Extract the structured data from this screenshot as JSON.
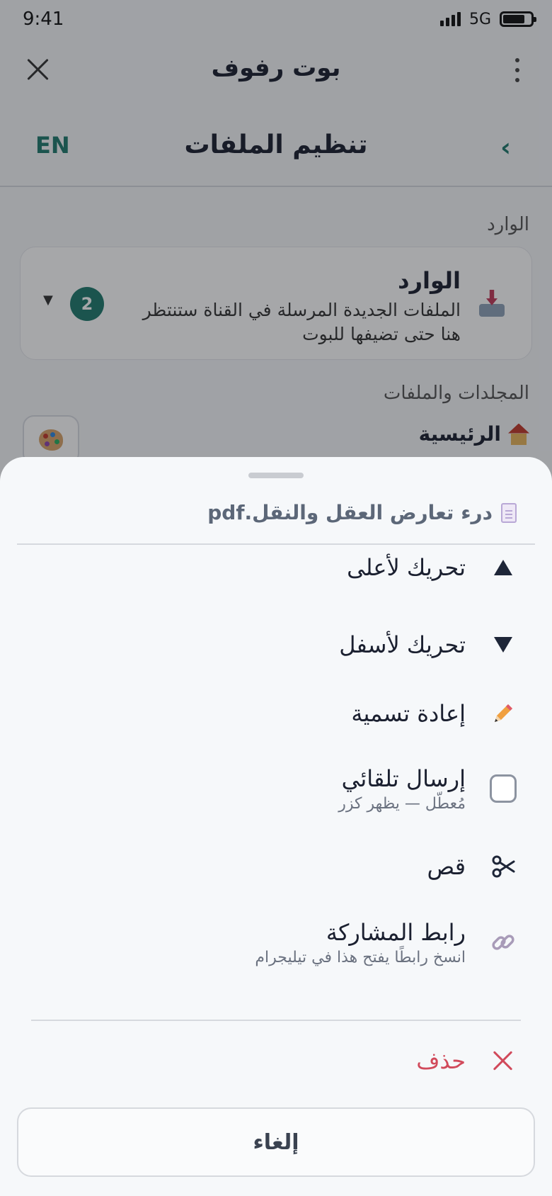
{
  "status_bar": {
    "time": "9:41",
    "network": "5G"
  },
  "app_bar": {
    "title": "بوت رفوف"
  },
  "page_header": {
    "title": "تنظيم الملفات",
    "lang_toggle": "EN",
    "back_glyph": "›"
  },
  "inbox_section": {
    "label": "الوارد",
    "card_title": "الوارد",
    "card_description": "الملفات الجديدة المرسلة في القناة ستنتظر هنا حتى تضيفها للبوت",
    "count": "2",
    "expand_glyph": "▼"
  },
  "folders_section": {
    "label": "المجلدات والملفات",
    "home_label": "الرئيسية"
  },
  "sheet": {
    "file_name": "درء تعارض العقل والنقل.pdf",
    "items": [
      {
        "label": "تحريك لأعلى",
        "icon": "triangle-up-icon"
      },
      {
        "label": "تحريك لأسفل",
        "icon": "triangle-down-icon"
      },
      {
        "label": "إعادة تسمية",
        "icon": "pencil-icon"
      },
      {
        "label": "إرسال تلقائي",
        "sublabel": "مُعطّل — يظهر كزر",
        "icon": "checkbox"
      },
      {
        "label": "قص",
        "icon": "scissors-icon"
      },
      {
        "label": "رابط المشاركة",
        "sublabel": "انسخ رابطًا يفتح هذا في تيليجرام",
        "icon": "link-icon"
      }
    ],
    "delete": {
      "label": "حذف",
      "icon": "close-icon"
    },
    "cancel_label": "إلغاء"
  },
  "colors": {
    "accent": "#1f7a6c",
    "danger": "#d14a5b",
    "sheet_bg": "#f6f8fa",
    "text_primary": "#1b2030",
    "text_secondary": "#6b7280"
  }
}
